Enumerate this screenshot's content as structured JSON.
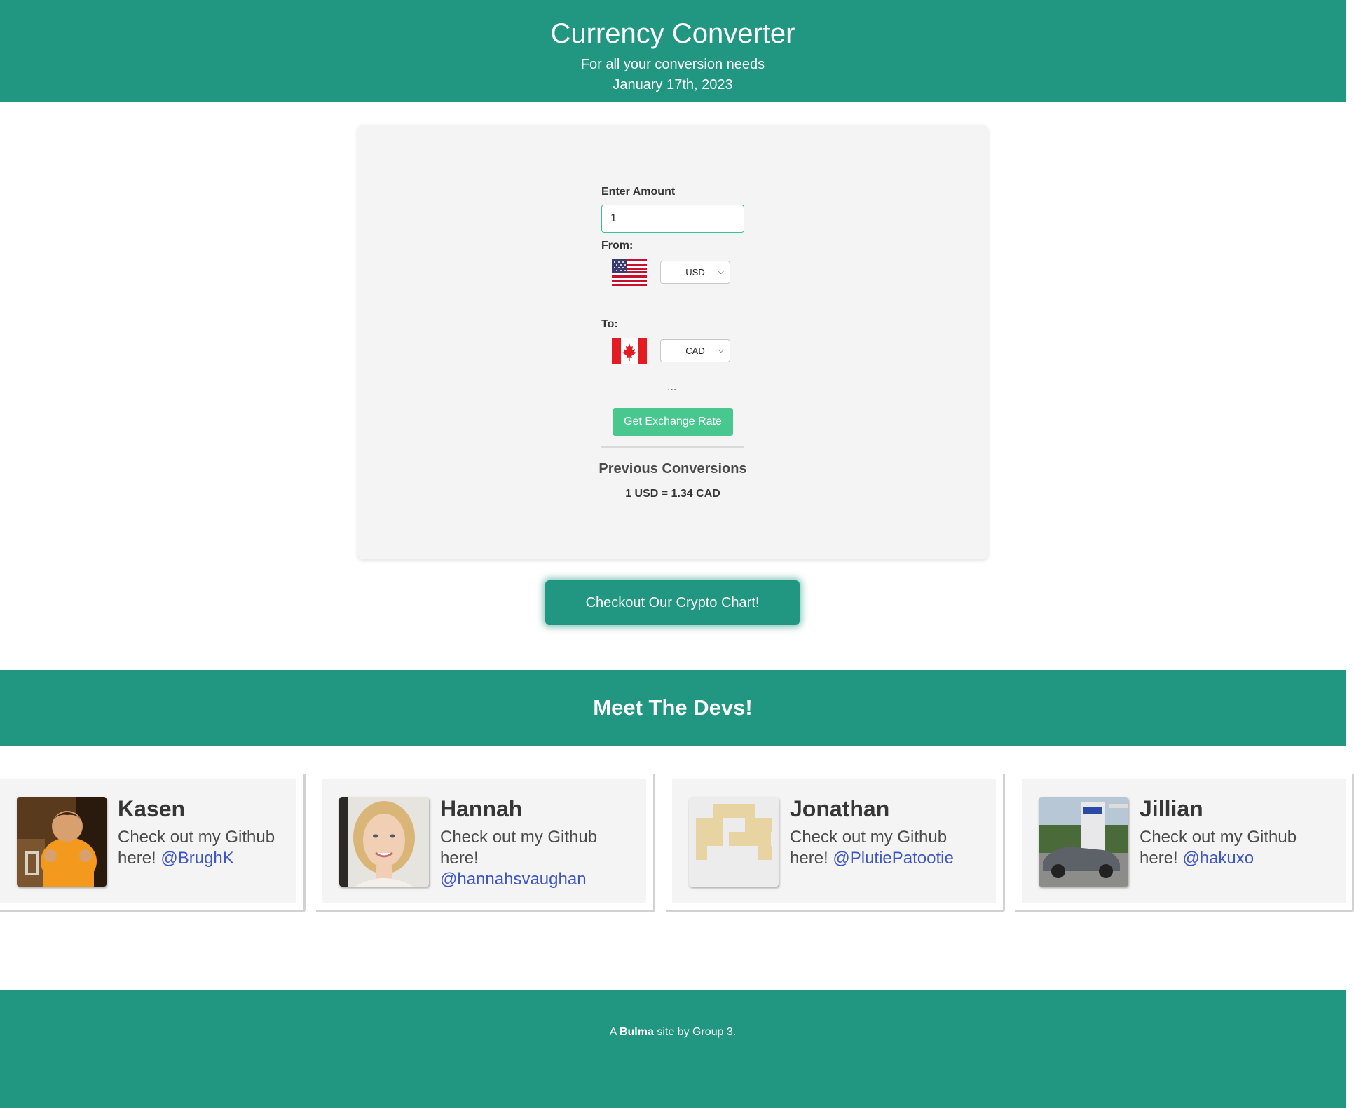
{
  "header": {
    "title": "Currency Converter",
    "subtitle": "For all your conversion needs",
    "date": "January 17th, 2023"
  },
  "converter": {
    "amount_label": "Enter Amount",
    "amount_value": "1",
    "from_label": "From:",
    "from_currency": "USD",
    "from_flag": "us-flag-icon",
    "to_label": "To:",
    "to_currency": "CAD",
    "to_flag": "canada-flag-icon",
    "result_placeholder": "...",
    "button_label": "Get Exchange Rate",
    "previous_title": "Previous Conversions",
    "previous": [
      "1 USD = 1.34 CAD"
    ]
  },
  "crypto_button": "Checkout Our Crypto Chart!",
  "devs": {
    "title": "Meet The Devs!",
    "cta_prefix": "Check out my Github here!",
    "list": [
      {
        "name": "Kasen",
        "handle": "@BrughK"
      },
      {
        "name": "Hannah",
        "handle": "@hannahsvaughan"
      },
      {
        "name": "Jonathan",
        "handle": "@PlutiePatootie"
      },
      {
        "name": "Jillian",
        "handle": "@hakuxo"
      }
    ]
  },
  "footer": {
    "prefix": "A",
    "brand": "Bulma",
    "suffix": "site by Group 3."
  },
  "colors": {
    "primary": "#219680",
    "button_green": "#48c78e",
    "link_blue": "#3e56c4",
    "card_bg": "#f4f4f4"
  }
}
